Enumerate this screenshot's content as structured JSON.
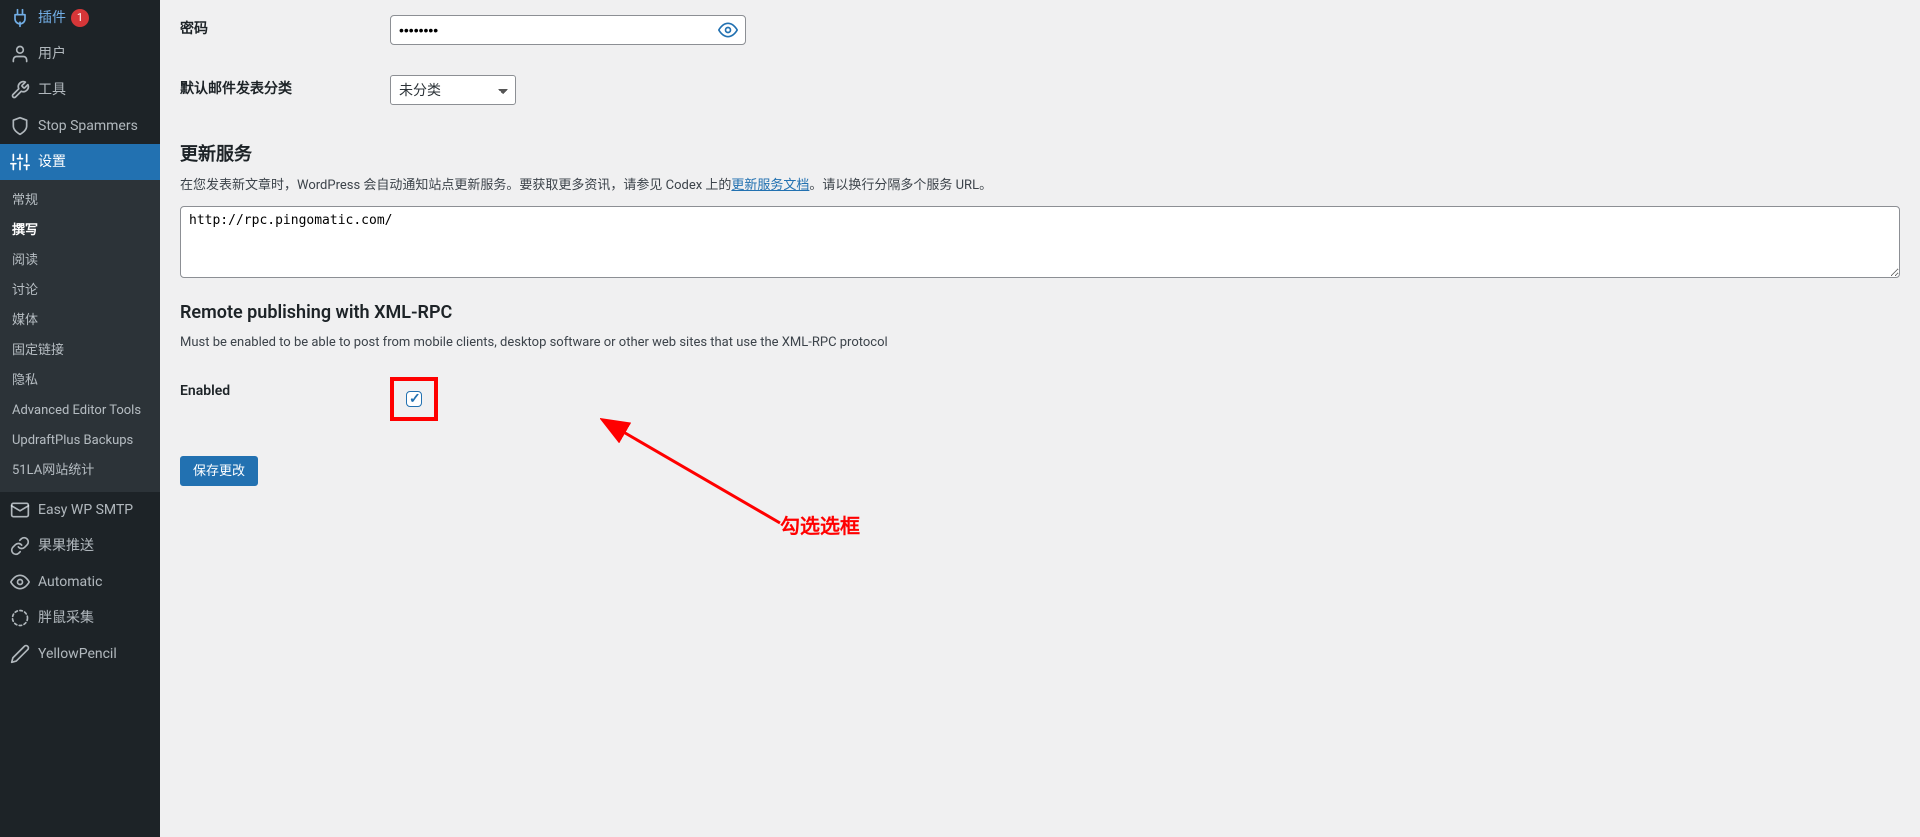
{
  "sidebar": {
    "top_items": [
      {
        "icon": "plug",
        "label": "插件",
        "badge": "1"
      },
      {
        "icon": "user",
        "label": "用户"
      },
      {
        "icon": "wrench",
        "label": "工具"
      },
      {
        "icon": "shield",
        "label": "Stop Spammers"
      },
      {
        "icon": "sliders",
        "label": "设置",
        "current": true
      }
    ],
    "sub_items": [
      {
        "label": "常规"
      },
      {
        "label": "撰写",
        "active": true
      },
      {
        "label": "阅读"
      },
      {
        "label": "讨论"
      },
      {
        "label": "媒体"
      },
      {
        "label": "固定链接"
      },
      {
        "label": "隐私"
      },
      {
        "label": "Advanced Editor Tools"
      },
      {
        "label": "UpdraftPlus Backups"
      },
      {
        "label": "51LA网站统计"
      }
    ],
    "bottom_items": [
      {
        "icon": "mail",
        "label": "Easy WP SMTP"
      },
      {
        "icon": "link",
        "label": "果果推送"
      },
      {
        "icon": "eye",
        "label": "Automatic"
      },
      {
        "icon": "circle",
        "label": "胖鼠采集"
      },
      {
        "icon": "pencil",
        "label": "YellowPencil"
      }
    ]
  },
  "form": {
    "password_label": "密码",
    "password_value": "••••••••",
    "category_label": "默认邮件发表分类",
    "category_value": "未分类",
    "update_heading": "更新服务",
    "update_desc_before": "在您发表新文章时，WordPress 会自动通知站点更新服务。要获取更多资讯，请参见 Codex 上的",
    "update_desc_link": "更新服务文档",
    "update_desc_after": "。请以换行分隔多个服务 URL。",
    "update_textarea": "http://rpc.pingomatic.com/",
    "xmlrpc_heading": "Remote publishing with XML-RPC",
    "xmlrpc_desc": "Must be enabled to be able to post from mobile clients, desktop software or other web sites that use the XML-RPC protocol",
    "enabled_label": "Enabled",
    "save_button": "保存更改"
  },
  "annotation": {
    "text": "勾选选框"
  }
}
